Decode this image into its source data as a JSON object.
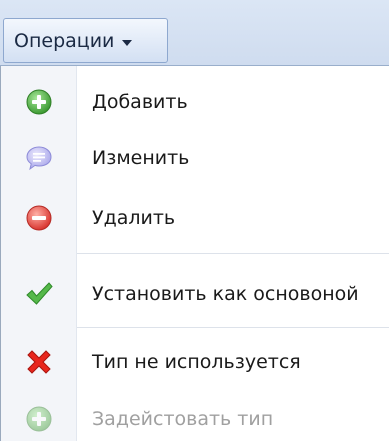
{
  "toolbar": {
    "menu_button_label": "Операции"
  },
  "menu": {
    "items": [
      {
        "label": "Добавить",
        "icon": "add-icon",
        "enabled": true
      },
      {
        "label": "Изменить",
        "icon": "edit-icon",
        "enabled": true
      },
      {
        "label": "Удалить",
        "icon": "delete-icon",
        "enabled": true
      },
      {
        "label": "Установить как основоной",
        "icon": "checkmark-icon",
        "enabled": true
      },
      {
        "label": "Тип не используется",
        "icon": "cross-icon",
        "enabled": true
      },
      {
        "label": "Задейстовать тип",
        "icon": "add-icon",
        "enabled": false
      }
    ]
  },
  "colors": {
    "add_green": "#4caf50",
    "edit_lavender": "#b7b6f2",
    "delete_red": "#e5484d",
    "check_green": "#3fa33a",
    "cross_red": "#e2231a",
    "disabled_text": "#a0a0a0"
  }
}
